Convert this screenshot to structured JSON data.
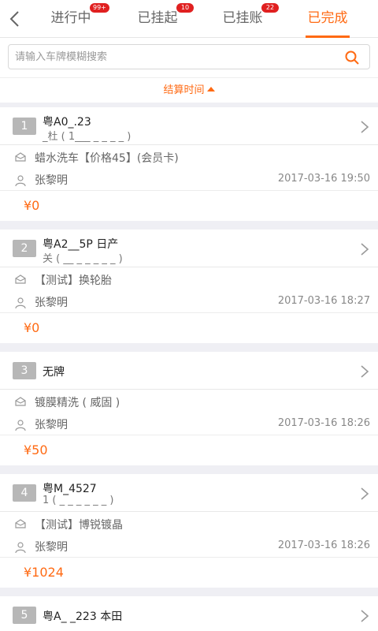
{
  "tabs": [
    {
      "label": "进行中",
      "badge": "99+",
      "active": false
    },
    {
      "label": "已挂起",
      "badge": "10",
      "active": false
    },
    {
      "label": "已挂账",
      "badge": "22",
      "active": false
    },
    {
      "label": "已完成",
      "badge": "",
      "active": true
    }
  ],
  "search": {
    "placeholder": "请输入车牌模糊搜索"
  },
  "sort": {
    "label": "结算时间"
  },
  "orders": [
    {
      "index": "1",
      "plate": "粤A0_.23",
      "owner": "_杜 ( 1___ _ _ _ _ )",
      "service": "蜡水洗车【价格45】(会员卡)",
      "staff": "张黎明",
      "time": "2017-03-16 19:50",
      "price": "¥0"
    },
    {
      "index": "2",
      "plate": "粤A2__5P 日产",
      "owner": "关 ( __ _ _ _ _ _ )",
      "service": "【测试】换轮胎",
      "staff": "张黎明",
      "time": "2017-03-16 18:27",
      "price": "¥0"
    },
    {
      "index": "3",
      "plate": "无牌",
      "owner": "",
      "service": "镀膜精洗 ( 威固 )",
      "staff": "张黎明",
      "time": "2017-03-16 18:26",
      "price": "¥50"
    },
    {
      "index": "4",
      "plate": "粤M_4527",
      "owner": "1 ( _ _ _ _ _ _ )",
      "service": "【测试】博锐镀晶",
      "staff": "张黎明",
      "time": "2017-03-16 18:26",
      "price": "¥1024"
    },
    {
      "index": "5",
      "plate": "粤A_ _223 本田",
      "owner": "",
      "service": "",
      "staff": "",
      "time": "",
      "price": ""
    }
  ],
  "colors": {
    "accent": "#ff6a13",
    "badge": "#e02020"
  }
}
